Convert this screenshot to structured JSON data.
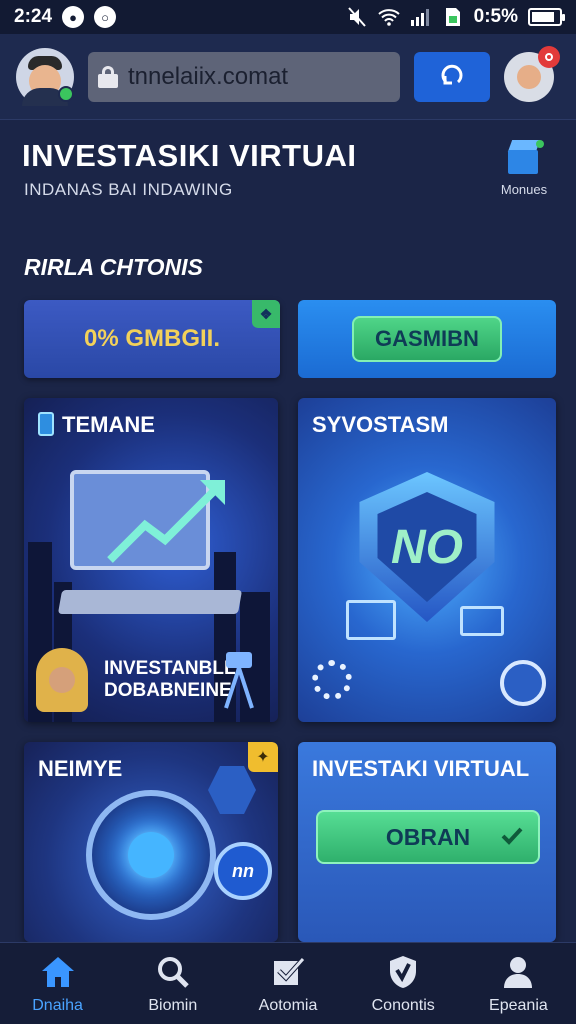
{
  "status_bar": {
    "time": "2:24",
    "battery": "0:5%",
    "battery_level": 0.85
  },
  "header": {
    "url": "tnnelaiix.comat",
    "go_icon": "refresh-icon"
  },
  "page": {
    "title": "INVESTASIKI VIRTUAI",
    "subtitle": "INDANAS BAI INDAWING",
    "menu_label": "Monues",
    "section_title": "RIRLA CHTONIS"
  },
  "actions": {
    "promo_label": "0% GMBGII.",
    "cta_label": "GASMIBN"
  },
  "cards": {
    "card1_title": "TEMANE",
    "card1_caption_line1": "INVESTANBLL",
    "card1_caption_line2": "DOBABNEINE",
    "card2_title": "SYVOSTASM",
    "card2_shield_text": "NO",
    "card3_title": "NEIMYE",
    "card3_coin_text": "nn",
    "card4_title": "INVESTAKI VIRTUAL",
    "card4_button": "OBRAN"
  },
  "bottom_nav": {
    "items": [
      {
        "label": "Dnaiha",
        "icon": "home-icon"
      },
      {
        "label": "Biomin",
        "icon": "search-icon"
      },
      {
        "label": "Aotomia",
        "icon": "checkbox-icon"
      },
      {
        "label": "Conontis",
        "icon": "shield-check-icon"
      },
      {
        "label": "Epeania",
        "icon": "user-icon"
      }
    ]
  },
  "colors": {
    "background": "#1b2547",
    "accent_blue": "#1f63d8",
    "accent_green": "#3bc55e",
    "promo_text": "#f2d15a",
    "active_nav": "#4aa3ff"
  }
}
